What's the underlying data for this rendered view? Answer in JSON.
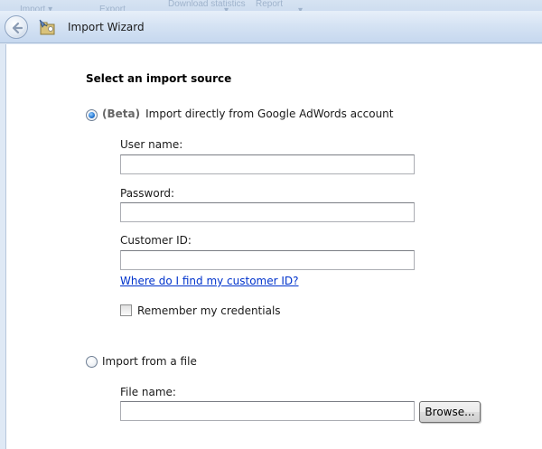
{
  "ribbon": {
    "items": [
      "Import ▾",
      "Export",
      "Download statistics",
      "▾",
      "Report",
      "▾"
    ]
  },
  "window": {
    "title": "Import Wizard",
    "back_icon": "back-arrow-icon",
    "app_icon": "import-wizard-icon"
  },
  "form": {
    "heading": "Select an import source",
    "option_adwords": {
      "badge": "(Beta)",
      "label": "Import directly from Google AdWords account",
      "selected": true
    },
    "username": {
      "label": "User name:",
      "value": ""
    },
    "password": {
      "label": "Password:",
      "value": ""
    },
    "customer_id": {
      "label": "Customer ID:",
      "value": ""
    },
    "help_link": "Where do I find my customer ID?",
    "remember": {
      "label": "Remember my credentials",
      "checked": false
    },
    "option_file": {
      "label": "Import from a file",
      "selected": false
    },
    "file_name": {
      "label": "File name:",
      "value": ""
    },
    "browse_label": "Browse..."
  },
  "colors": {
    "link": "#0033cc",
    "chrome": "#dfe9f5",
    "radio_selected": "#2a7bd6"
  }
}
